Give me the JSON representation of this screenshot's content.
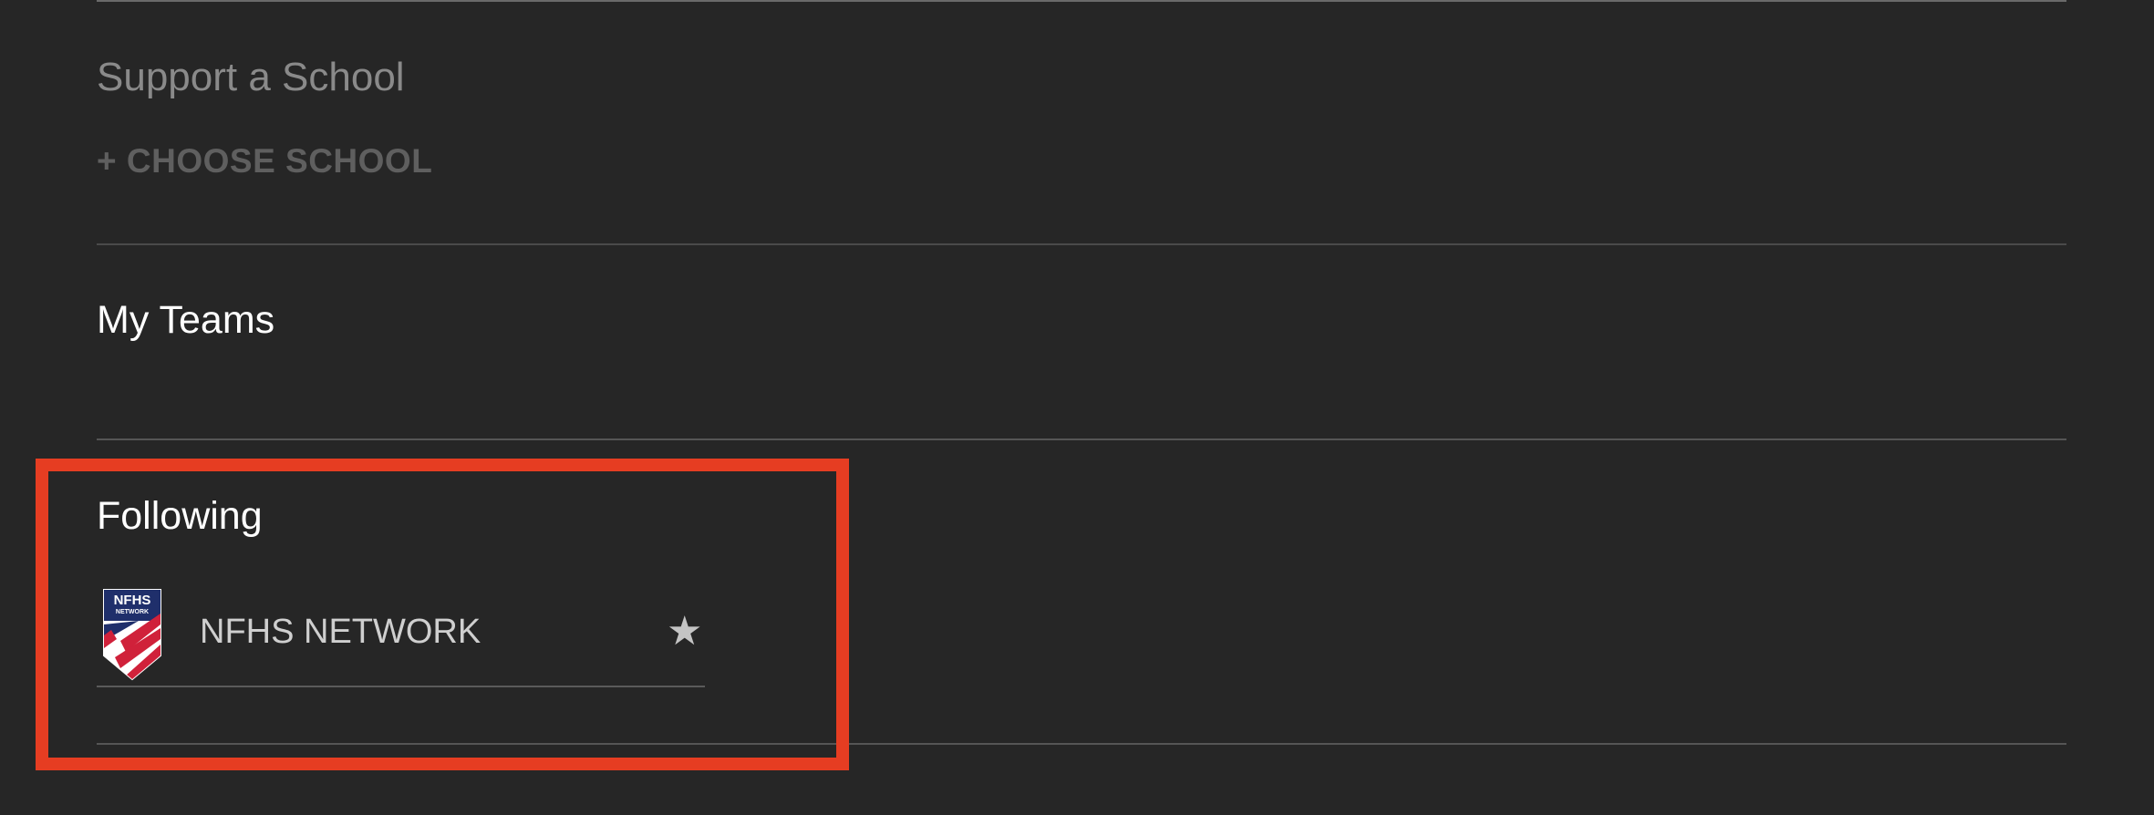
{
  "support": {
    "title": "Support a School",
    "choose_label": "+ CHOOSE SCHOOL"
  },
  "my_teams": {
    "title": "My Teams"
  },
  "following": {
    "title": "Following",
    "items": [
      {
        "name": "NFHS NETWORK",
        "logo_text_top": "NFHS",
        "logo_text_bottom": "NETWORK",
        "favorite": true,
        "icon": "star-icon"
      }
    ]
  },
  "colors": {
    "background": "#262626",
    "highlight": "#e63d22",
    "logo_navy": "#1f2f6b",
    "logo_red": "#d0213a"
  }
}
